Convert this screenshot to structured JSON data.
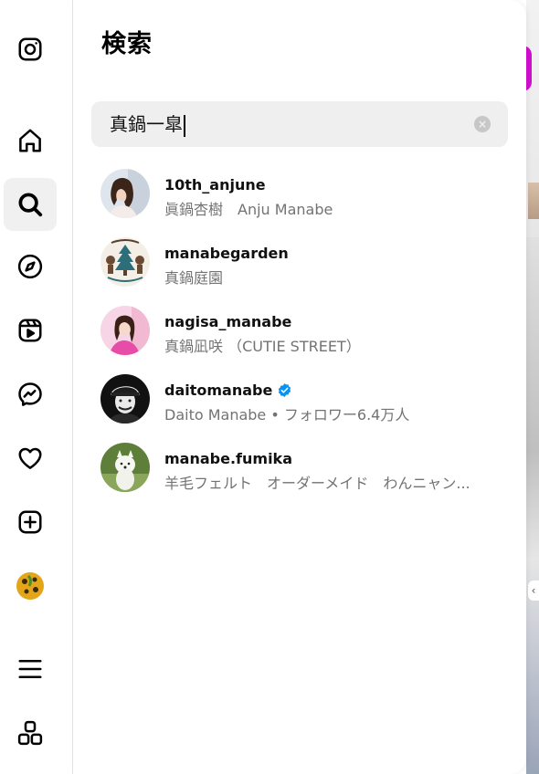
{
  "panel": {
    "title": "検索"
  },
  "search": {
    "value": "真鍋一皐"
  },
  "results": [
    {
      "username": "10th_anjune",
      "subtitle": "眞鍋杏樹　Anju Manabe",
      "verified": false
    },
    {
      "username": "manabegarden",
      "subtitle": "真鍋庭園",
      "verified": false
    },
    {
      "username": "nagisa_manabe",
      "subtitle": "真鍋凪咲 （CUTIE STREET）",
      "verified": false
    },
    {
      "username": "daitomanabe",
      "subtitle": "Daito Manabe • フォロワー6.4万人",
      "verified": true
    },
    {
      "username": "manabe.fumika",
      "subtitle": "羊毛フェルト　オーダーメイド　わんニャン...",
      "verified": false
    }
  ],
  "nav": {
    "items": [
      "instagram-logo",
      "home",
      "search",
      "explore",
      "reels",
      "messages",
      "notifications",
      "create",
      "profile",
      "more",
      "also-from-meta"
    ],
    "active": "search"
  },
  "colors": {
    "verified": "#0095f6",
    "accent_bg_strip": "#d10fcf"
  }
}
